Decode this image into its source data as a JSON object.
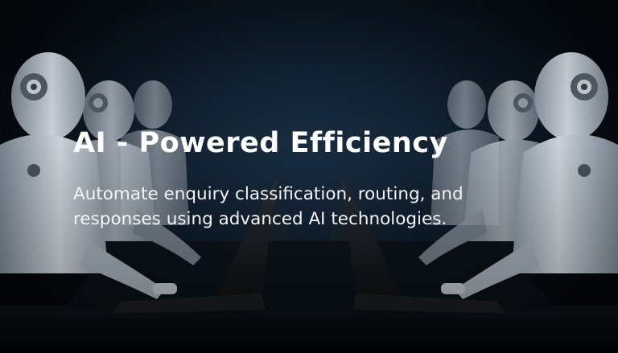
{
  "hero": {
    "title": "AI - Powered Efficiency",
    "subtitle": "Automate enquiry classification, routing, and responses using advanced AI technologies."
  },
  "image": {
    "subject": "humanoid-robots-at-laptops",
    "palette": {
      "background": "#05080d",
      "glow": "#14283c",
      "robot_light": "#d8dfe6",
      "robot_shadow": "#5a6672",
      "laptop": "#1a1d21"
    }
  }
}
